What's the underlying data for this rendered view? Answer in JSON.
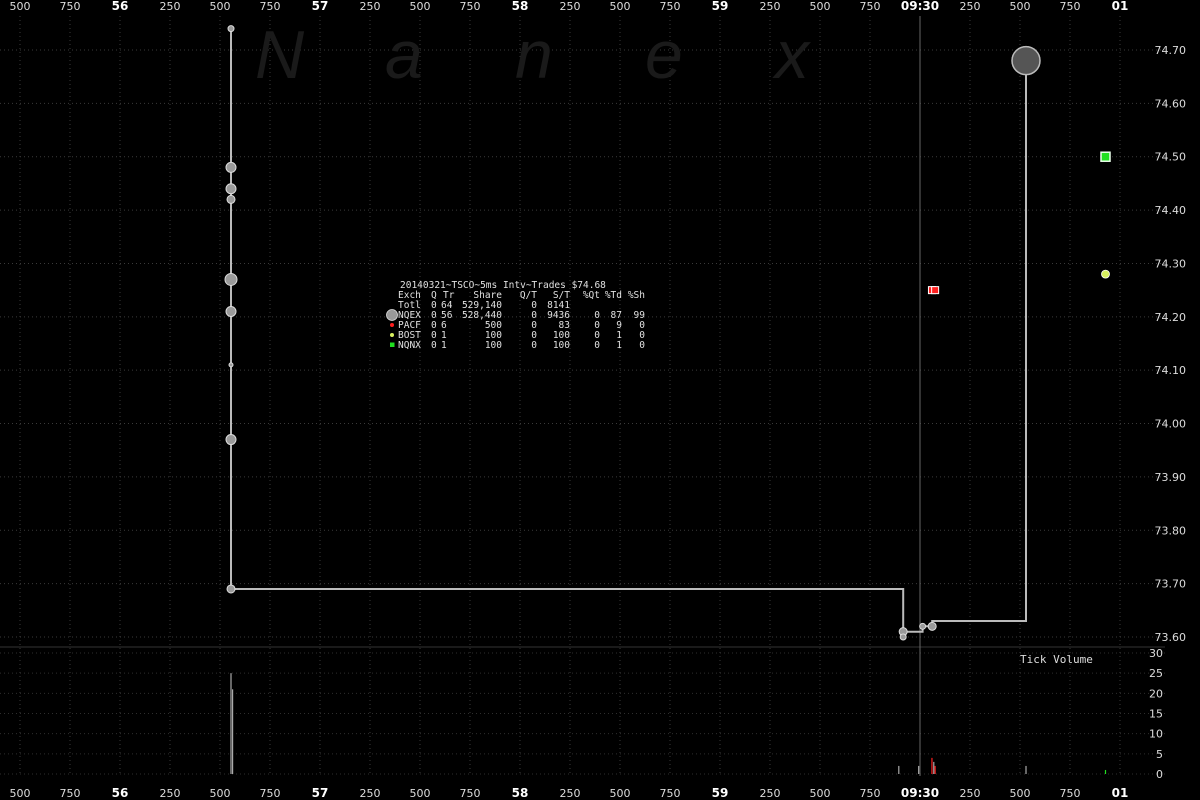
{
  "chart_data": {
    "type": "scatter",
    "title": "20140321~TSCO~5ms Intv~Trades $74.68",
    "watermark": [
      "N",
      "a",
      "n",
      "e",
      "x"
    ],
    "x_tick_labels": [
      {
        "label": "500",
        "bold": false
      },
      {
        "label": "750",
        "bold": false
      },
      {
        "label": "56",
        "bold": true
      },
      {
        "label": "250",
        "bold": false
      },
      {
        "label": "500",
        "bold": false
      },
      {
        "label": "750",
        "bold": false
      },
      {
        "label": "57",
        "bold": true
      },
      {
        "label": "250",
        "bold": false
      },
      {
        "label": "500",
        "bold": false
      },
      {
        "label": "750",
        "bold": false
      },
      {
        "label": "58",
        "bold": true
      },
      {
        "label": "250",
        "bold": false
      },
      {
        "label": "500",
        "bold": false
      },
      {
        "label": "750",
        "bold": false
      },
      {
        "label": "59",
        "bold": true
      },
      {
        "label": "250",
        "bold": false
      },
      {
        "label": "500",
        "bold": false
      },
      {
        "label": "750",
        "bold": false
      },
      {
        "label": "09:30",
        "bold": true
      },
      {
        "label": "250",
        "bold": false
      },
      {
        "label": "500",
        "bold": false
      },
      {
        "label": "750",
        "bold": false
      },
      {
        "label": "01",
        "bold": true
      }
    ],
    "y_axis": {
      "ticks": [
        "74.70",
        "74.60",
        "74.50",
        "74.40",
        "74.30",
        "74.20",
        "74.10",
        "74.00",
        "73.90",
        "73.80",
        "73.70",
        "73.60"
      ],
      "ylim": [
        73.58,
        74.72
      ]
    },
    "volume_axis": {
      "label": "Tick Volume",
      "ticks": [
        "30",
        "25",
        "20",
        "15",
        "10",
        "5",
        "0"
      ],
      "ylim": [
        0,
        30
      ]
    },
    "grid": true,
    "stats_table": {
      "header": [
        "Exch",
        "Q",
        "Tr",
        "Share",
        "Q/T",
        "S/T",
        "%Qt",
        "%Td",
        "%Sh"
      ],
      "rows": [
        {
          "marker": "none",
          "color": "#000000",
          "cells": [
            "Totl",
            "0",
            "64",
            "529,140",
            "0",
            "8141",
            "",
            "",
            ""
          ]
        },
        {
          "marker": "big-circle",
          "color": "#888888",
          "cells": [
            "NQEX",
            "0",
            "56",
            "528,440",
            "0",
            "9436",
            "0",
            "87",
            "99"
          ]
        },
        {
          "marker": "dot",
          "color": "#ff2020",
          "cells": [
            "PACF",
            "0",
            "6",
            "500",
            "0",
            "83",
            "0",
            "9",
            "0"
          ]
        },
        {
          "marker": "dot",
          "color": "#d8f060",
          "cells": [
            "BOST",
            "0",
            "1",
            "100",
            "0",
            "100",
            "0",
            "1",
            "0"
          ]
        },
        {
          "marker": "square",
          "color": "#20e020",
          "cells": [
            "NQNX",
            "0",
            "1",
            "100",
            "0",
            "100",
            "0",
            "1",
            "0"
          ]
        }
      ]
    },
    "series": [
      {
        "name": "NQEX",
        "color": "#aaaaaa",
        "points": [
          {
            "t": 0.0,
            "p": 74.74,
            "r": 3
          },
          {
            "t": 0.0,
            "p": 74.48,
            "r": 5
          },
          {
            "t": 0.0,
            "p": 74.44,
            "r": 5
          },
          {
            "t": 0.0,
            "p": 74.42,
            "r": 4
          },
          {
            "t": 0.0,
            "p": 74.27,
            "r": 6
          },
          {
            "t": 0.0,
            "p": 74.21,
            "r": 5
          },
          {
            "t": 0.0,
            "p": 74.11,
            "r": 2
          },
          {
            "t": 0.0,
            "p": 73.97,
            "r": 5
          },
          {
            "t": 0.0,
            "p": 73.69,
            "r": 4
          },
          {
            "t": 0.8455,
            "p": 73.61,
            "r": 4
          },
          {
            "t": 0.8455,
            "p": 73.6,
            "r": 3
          },
          {
            "t": 0.87,
            "p": 73.62,
            "r": 3
          },
          {
            "t": 0.882,
            "p": 73.62,
            "r": 4
          },
          {
            "t": 1.0,
            "p": 74.68,
            "r": 14
          }
        ]
      },
      {
        "name": "PACF",
        "color": "#ff2020",
        "points": [
          {
            "t": 0.8817,
            "p": 74.25
          },
          {
            "t": 0.8857,
            "p": 74.25
          }
        ]
      },
      {
        "name": "BOST",
        "color": "#d8f060",
        "points": [
          {
            "t": 1.1,
            "p": 74.28
          }
        ]
      },
      {
        "name": "NQNX",
        "color": "#20e020",
        "points": [
          {
            "t": 1.1,
            "p": 74.5
          }
        ]
      }
    ],
    "price_path": [
      {
        "t": 0.0,
        "p": 74.74
      },
      {
        "t": 0.0,
        "p": 73.69
      },
      {
        "t": 0.8455,
        "p": 73.69
      },
      {
        "t": 0.8455,
        "p": 73.61
      },
      {
        "t": 0.87,
        "p": 73.61
      },
      {
        "t": 0.87,
        "p": 73.62
      },
      {
        "t": 0.882,
        "p": 73.62
      },
      {
        "t": 0.882,
        "p": 73.63
      },
      {
        "t": 1.0,
        "p": 73.63
      },
      {
        "t": 1.0,
        "p": 74.68
      }
    ],
    "volume_bars": [
      {
        "t": 0.0,
        "v": 25,
        "color": "#aaaaaa"
      },
      {
        "t": 0.002,
        "v": 21,
        "color": "#aaaaaa"
      },
      {
        "t": 0.84,
        "v": 2,
        "color": "#aaaaaa"
      },
      {
        "t": 0.865,
        "v": 2,
        "color": "#aaaaaa"
      },
      {
        "t": 0.8817,
        "v": 4,
        "color": "#ff2020"
      },
      {
        "t": 0.8857,
        "v": 2,
        "color": "#ff2020"
      },
      {
        "t": 0.884,
        "v": 3,
        "color": "#aaaaaa"
      },
      {
        "t": 1.0,
        "v": 2,
        "color": "#aaaaaa"
      },
      {
        "t": 1.1,
        "v": 1,
        "color": "#20e020"
      }
    ]
  }
}
